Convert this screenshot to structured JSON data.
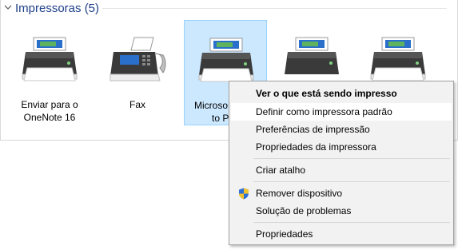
{
  "group": {
    "title": "Impressoras (5)"
  },
  "devices": [
    {
      "line1": "Enviar para o",
      "line2": "OneNote 16",
      "icon": "printer-icon"
    },
    {
      "line1": "Fax",
      "line2": "",
      "icon": "fax-icon"
    },
    {
      "line1": "Microso",
      "line2": "to P",
      "icon": "printer-icon",
      "selected": true
    },
    {
      "line1": "",
      "line2": "",
      "icon": "printer-icon"
    },
    {
      "line1": "",
      "line2": "",
      "icon": "printer-icon"
    }
  ],
  "menu": {
    "see_printing": "Ver o que está sendo impresso",
    "set_default": "Definir como impressora padrão",
    "print_prefs": "Preferências de impressão",
    "printer_props": "Propriedades da impressora",
    "create_shortcut": "Criar atalho",
    "remove_device": "Remover dispositivo",
    "troubleshoot": "Solução de problemas",
    "properties": "Propriedades"
  },
  "colors": {
    "selection": "#cce8ff",
    "header_text": "#1e3f8a",
    "menu_bg": "#f2f2f2"
  }
}
